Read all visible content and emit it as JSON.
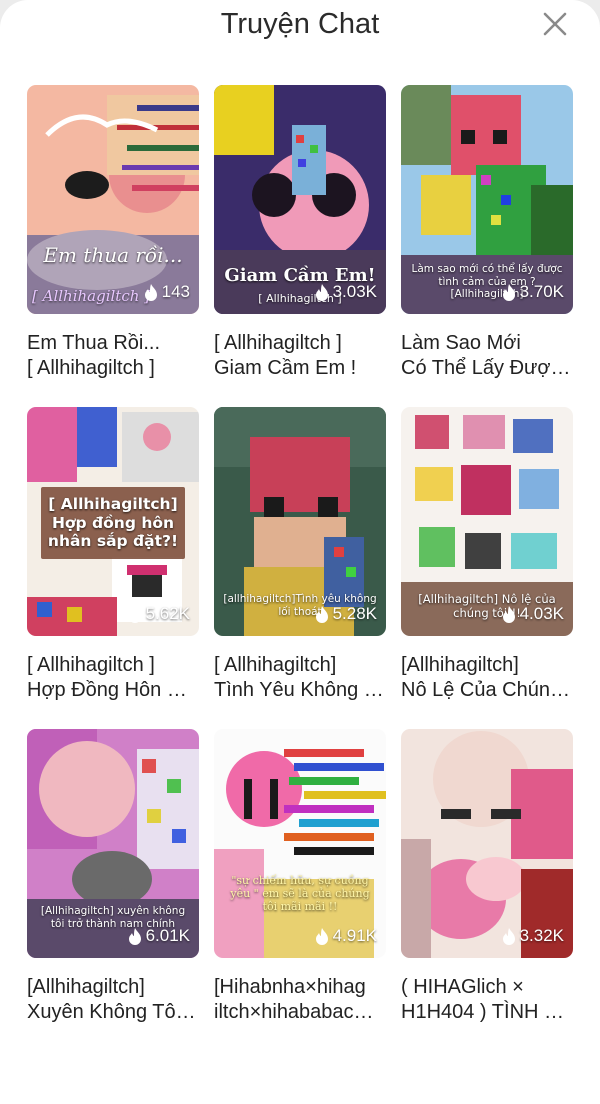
{
  "header": {
    "title": "Truyện Chat"
  },
  "icons": {
    "close": "close-icon",
    "views": "flame-icon"
  },
  "stories": [
    {
      "line1": "Em Thua Rồi...",
      "line2": "[ Allhihagiltch ]",
      "views": "143",
      "caption": "Em thua rồi...",
      "subcaption": "[ Allhihagiltch ]"
    },
    {
      "line1": "[ Allhihagiltch ]",
      "line2": "Giam Cầm Em !",
      "views": "3.03K",
      "caption": "Giam Cầm Em!",
      "subcaption": "[ Allhihagiltch ]"
    },
    {
      "line1": "Làm Sao Mới",
      "line2": "Có Thể Lấy Được…",
      "views": "3.70K",
      "caption": "Làm sao mới có thể lấy được tình cảm của em ? [Allhihagiltch]",
      "subcaption": ""
    },
    {
      "line1": "[ Allhihagiltch ]",
      "line2": "Hợp Đồng Hôn …",
      "views": "5.62K",
      "caption": "[ Allhihagiltch] Hợp đồng hôn nhân sắp đặt?!",
      "subcaption": ""
    },
    {
      "line1": "[ Allhihagiltch]",
      "line2": "Tình Yêu Không …",
      "views": "5.28K",
      "caption": "[allhihagiltch]Tình yêu không lối thoát",
      "subcaption": ""
    },
    {
      "line1": "[Allhihagiltch]",
      "line2": "Nô Lệ Của Chún…",
      "views": "4.03K",
      "caption": "[Allhihagiltch] Nô lệ của chúng tôi!!!",
      "subcaption": ""
    },
    {
      "line1": "[Allhihagiltch]",
      "line2": "Xuyên Không Tô…",
      "views": "6.01K",
      "caption": "[Allhihagiltch] xuyên không tôi trở thành nam chính",
      "subcaption": ""
    },
    {
      "line1": "[Hihabnha×hihag",
      "line2": "iltch×hihababac…",
      "views": "4.91K",
      "caption": "\"sự chiếm hữu, sự cuồng yêu \" em sẽ là của chúng tôi mãi mãi !!",
      "subcaption": ""
    },
    {
      "line1": "( HIHAGlich ×",
      "line2": "H1H404 ) TÌNH …",
      "views": "3.32K",
      "caption": "",
      "subcaption": ""
    }
  ],
  "colors": {
    "background": "#ffffff",
    "title": "#2b2b2b",
    "text": "#222222",
    "close": "#8a8a8a"
  }
}
